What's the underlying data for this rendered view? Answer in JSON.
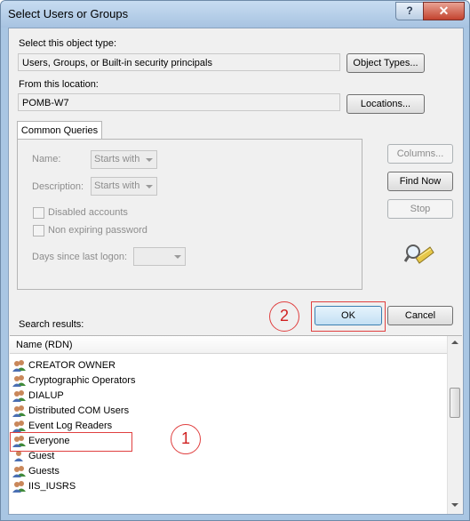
{
  "window": {
    "title": "Select Users or Groups",
    "help_glyph": "?",
    "close_glyph": "✕"
  },
  "object_type": {
    "label": "Select this object type:",
    "value": "Users, Groups, or Built-in security principals",
    "button": "Object Types..."
  },
  "location": {
    "label": "From this location:",
    "value": "POMB-W7",
    "button": "Locations..."
  },
  "queries": {
    "tab": "Common Queries",
    "name_label": "Name:",
    "name_mode": "Starts with",
    "description_label": "Description:",
    "description_mode": "Starts with",
    "disabled_accounts": "Disabled accounts",
    "non_expiring": "Non expiring password",
    "days_label": "Days since last logon:"
  },
  "side_buttons": {
    "columns": "Columns...",
    "find_now": "Find Now",
    "stop": "Stop"
  },
  "actions": {
    "ok": "OK",
    "cancel": "Cancel"
  },
  "results": {
    "label": "Search results:",
    "column": "Name (RDN)",
    "items": [
      "CREATOR OWNER",
      "Cryptographic Operators",
      "DIALUP",
      "Distributed COM Users",
      "Event Log Readers",
      "Everyone",
      "Guest",
      "Guests",
      "IIS_IUSRS"
    ]
  },
  "annotations": {
    "marker_1": "1",
    "marker_2": "2",
    "highlight_color": "#e04040"
  }
}
